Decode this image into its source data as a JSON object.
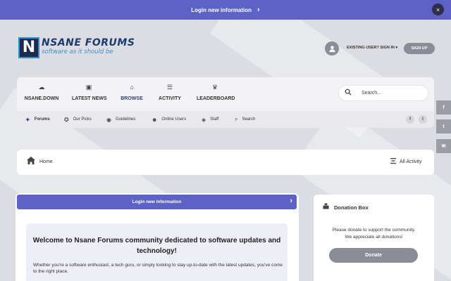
{
  "banner": {
    "text": "Login new information",
    "chevron": "›",
    "close": "×"
  },
  "logo": {
    "mark": "N",
    "title": "NSANE FORUMS",
    "tagline": "software as it should be"
  },
  "header": {
    "signin": "EXISTING USER? SIGN IN ▾",
    "signup": "SIGN UP"
  },
  "nav": {
    "items": [
      {
        "label": "NSANE.DOWN",
        "icon": "☁"
      },
      {
        "label": "LATEST NEWS",
        "icon": "▣"
      },
      {
        "label": "BROWSE",
        "icon": "⌂"
      },
      {
        "label": "ACTIVITY",
        "icon": "☰"
      },
      {
        "label": "LEADERBOARD",
        "icon": "♛"
      }
    ],
    "search_placeholder": "Search..."
  },
  "subnav": {
    "items": [
      {
        "label": "Forums",
        "icon": "✦"
      },
      {
        "label": "Our Picks",
        "icon": "✪"
      },
      {
        "label": "Guidelines",
        "icon": "◉"
      },
      {
        "label": "Online Users",
        "icon": "☻"
      },
      {
        "label": "Staff",
        "icon": "◈"
      },
      {
        "label": "Search",
        "icon": "⌕"
      }
    ],
    "social": [
      "f",
      "t"
    ]
  },
  "share": [
    "f",
    "t",
    "✉"
  ],
  "breadcrumb": {
    "home": "Home",
    "activity": "All Activity"
  },
  "main": {
    "login_bar": "Login new information",
    "welcome_title": "Welcome to Nsane Forums community dedicated to software updates and technology!",
    "welcome_text": "Whether you're a software enthusiast, a tech guru, or simply looking to stay up-to-date with the latest updates, you've come to the right place."
  },
  "donation": {
    "title": "Donation Box",
    "text_line1": "Please donate to support the community.",
    "text_line2": "We appreciate all donations!",
    "button": "Donate"
  },
  "colors": {
    "accent": "#5d62c6",
    "navy": "#2f3f7a",
    "gray_button": "#8a8d98"
  }
}
